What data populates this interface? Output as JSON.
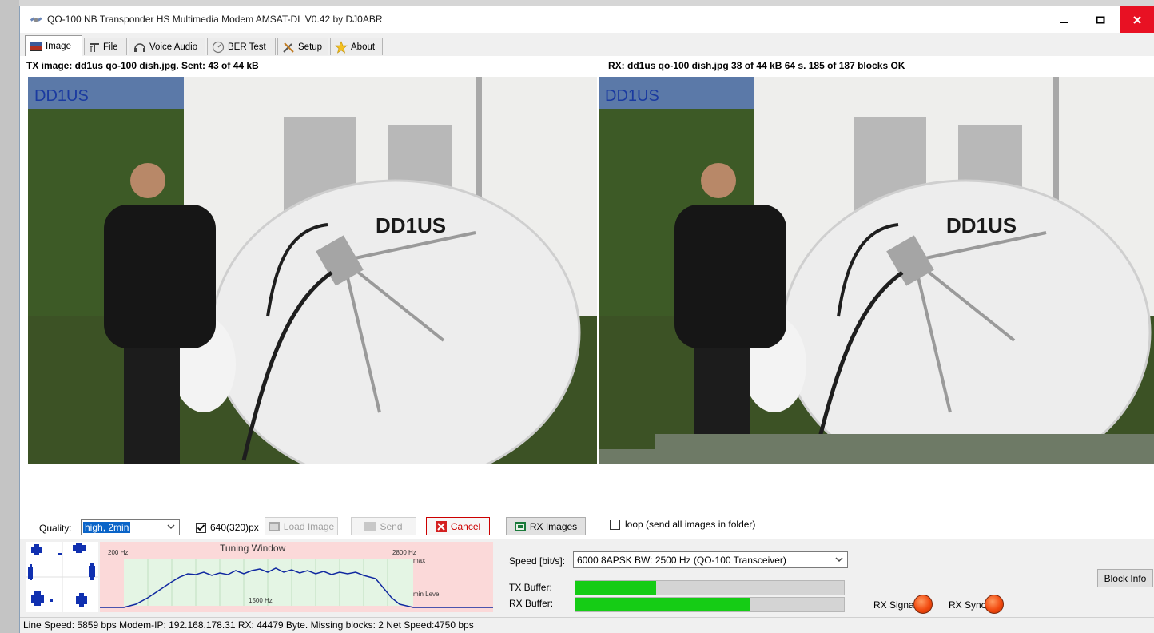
{
  "window": {
    "title": "QO-100 NB Transponder HS Multimedia Modem AMSAT-DL V0.42 by DJ0ABR",
    "min_icon": "minimize-icon",
    "max_icon": "maximize-icon",
    "close_icon": "close-icon"
  },
  "tabs": [
    {
      "label": "Image",
      "icon": "image-icon",
      "active": true
    },
    {
      "label": "File",
      "icon": "text-icon",
      "active": false
    },
    {
      "label": "Voice Audio",
      "icon": "headphones-icon",
      "active": false
    },
    {
      "label": "BER Test",
      "icon": "gauge-icon",
      "active": false
    },
    {
      "label": "Setup",
      "icon": "tools-icon",
      "active": false
    },
    {
      "label": "About",
      "icon": "star-icon",
      "active": false
    }
  ],
  "image_tab": {
    "tx_caption": "TX image: dd1us qo-100 dish.jpg. Sent: 43 of 44 kB",
    "rx_caption": "RX: dd1us qo-100 dish.jpg 38 of 44 kB 64 s. 185 of 187 blocks OK",
    "photo_watermark": "DD1US",
    "dish_text": "DD1US"
  },
  "controls": {
    "quality_label": "Quality:",
    "quality_value": "high, 2min",
    "resolution_checked": true,
    "resolution_label": "640(320)px",
    "load_image": "Load Image",
    "send": "Send",
    "cancel": "Cancel",
    "rx_images": "RX Images",
    "loop_checked": false,
    "loop_label": "loop (send all images in folder)"
  },
  "spectrum": {
    "title": "Tuning Window",
    "low_freq": "200 Hz",
    "high_freq": "2800 Hz",
    "center_freq": "1500 Hz",
    "max_label": "max",
    "min_level_label": "min Level"
  },
  "modem": {
    "speed_label": "Speed [bit/s]:",
    "speed_value": "6000 8APSK BW: 2500 Hz (QO-100 Transceiver)",
    "tx_buffer_label": "TX Buffer:",
    "rx_buffer_label": "RX Buffer:",
    "tx_buffer_level": 0.3,
    "rx_buffer_level": 0.65,
    "rx_signal_label": "RX Signal:",
    "rx_sync_label": "RX Sync:",
    "block_info": "Block Info",
    "led_color": "#f24a10",
    "buffer_color": "#15cc15"
  },
  "status_bar": {
    "text": "Line Speed: 5859 bps  Modem-IP: 192.168.178.31  RX: 44479 Byte. Missing blocks: 2 Net Speed:4750 bps"
  }
}
